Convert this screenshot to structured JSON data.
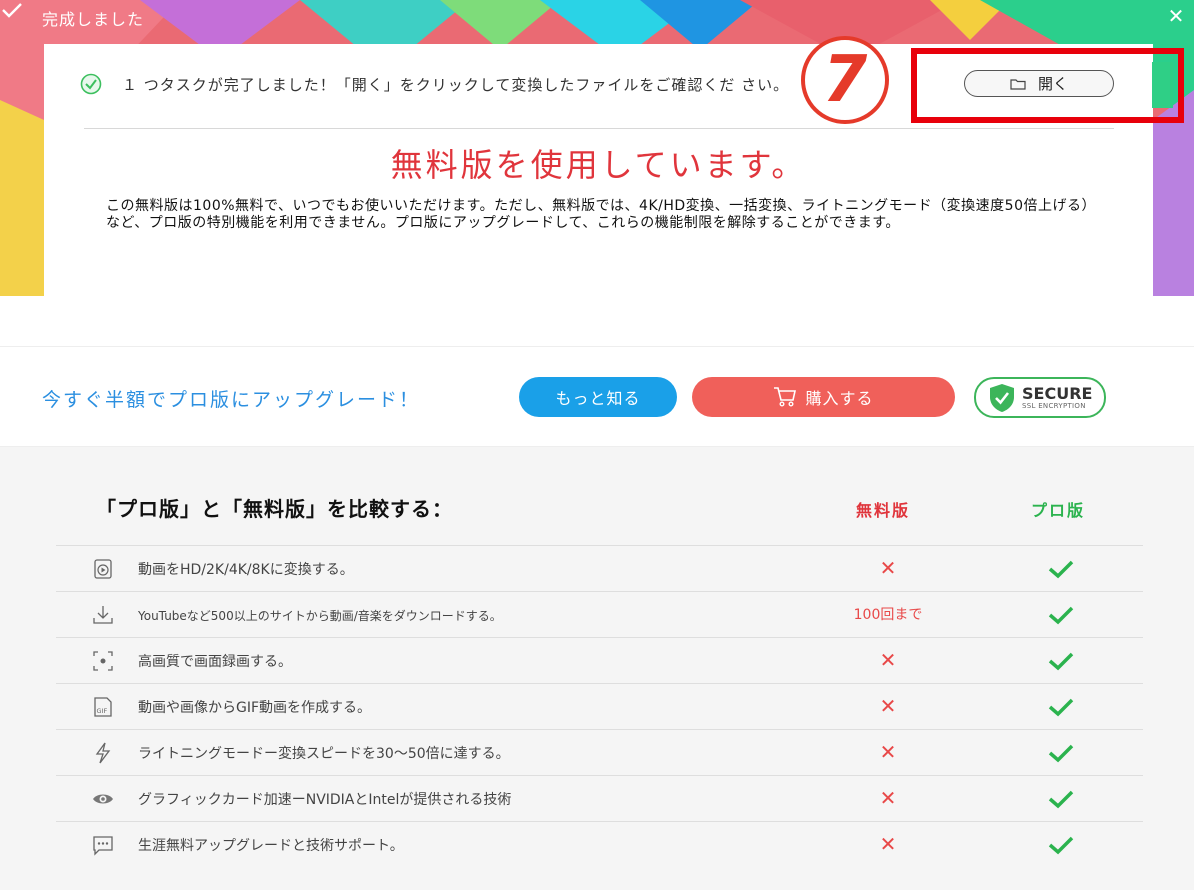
{
  "window": {
    "title": "完成しました",
    "close_glyph": "✕"
  },
  "notice": {
    "message": "１ つタスクが完了しました！「開く」をクリックして変換したファイルをご確認くだ さい。",
    "open_button": "開く",
    "annotation_number": "7"
  },
  "free_banner": {
    "title": "無料版を使用しています。",
    "description": "この無料版は100%無料で、いつでもお使いいただけます。ただし、無料版では、4K/HD変換、一括変換、ライトニングモード（変換速度50倍上げる）など、プロ版の特別機能を利用できません。プロ版にアップグレードして、これらの機能制限を解除することができます。"
  },
  "promo": {
    "text": "今すぐ半額でプロ版にアップグレード！",
    "learn_more": "もっと知る",
    "buy": "購入する",
    "secure_main": "SECURE",
    "secure_sub": "SSL ENCRYPTION"
  },
  "comparison": {
    "title": "「プロ版」と「無料版」を比較する：",
    "col_free": "無料版",
    "col_pro": "プロ版",
    "rows": [
      {
        "icon": "video-play-icon",
        "feature": "動画をHD/2K/4K/8Kに変換する。",
        "free": "✕",
        "pro": "check"
      },
      {
        "icon": "download-icon",
        "feature": "YouTubeなど500以上のサイトから動画/音楽をダウンロードする。",
        "free": "100回まで",
        "pro": "check"
      },
      {
        "icon": "screen-record-icon",
        "feature": "高画質で画面録画する。",
        "free": "✕",
        "pro": "check"
      },
      {
        "icon": "gif-icon",
        "feature": "動画や画像からGIF動画を作成する。",
        "free": "✕",
        "pro": "check"
      },
      {
        "icon": "lightning-icon",
        "feature": "ライトニングモードー変換スピードを30～50倍に達する。",
        "free": "✕",
        "pro": "check"
      },
      {
        "icon": "gpu-eye-icon",
        "feature": "グラフィックカード加速ーNVIDIAとIntelが提供される技術",
        "free": "✕",
        "pro": "check"
      },
      {
        "icon": "support-chat-icon",
        "feature": "生涯無料アップグレードと技術サポート。",
        "free": "✕",
        "pro": "check"
      }
    ]
  },
  "colors": {
    "free_red": "#e0353c",
    "pro_green": "#2bb34e",
    "learn_more_blue": "#1aa0e8",
    "buy_coral": "#f0605a",
    "annotation_red": "#e8000b"
  }
}
